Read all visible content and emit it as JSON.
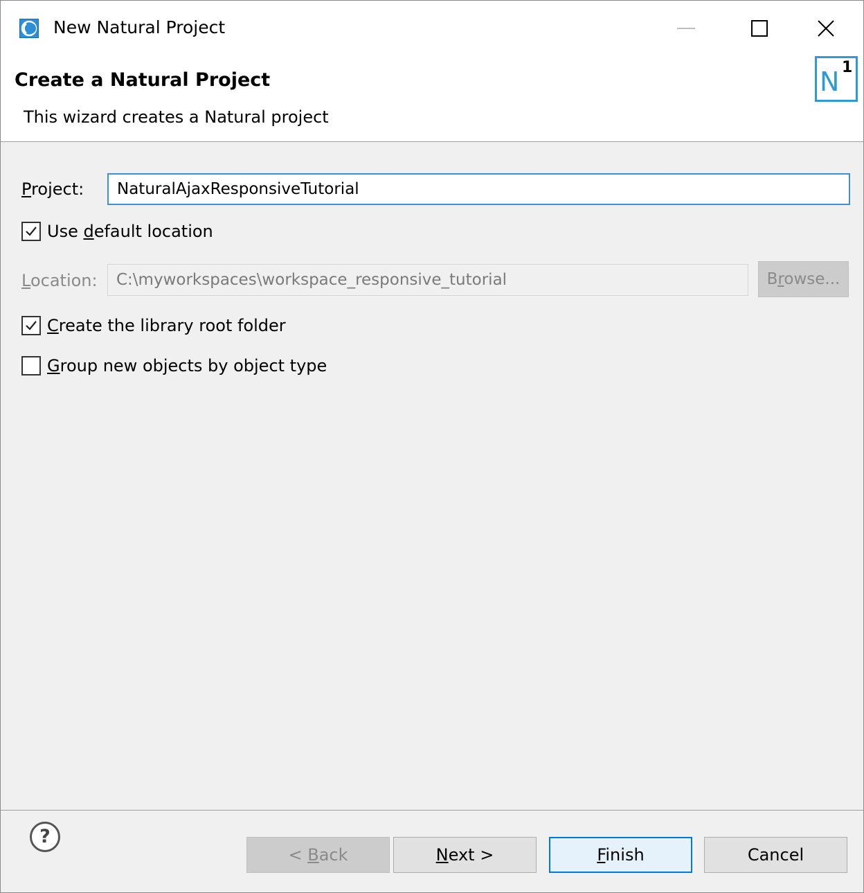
{
  "window": {
    "title": "New Natural Project",
    "icon": "natural-app-icon",
    "controls": {
      "minimize": "minimize-icon",
      "maximize": "maximize-icon",
      "close": "close-icon"
    }
  },
  "banner": {
    "title": "Create a Natural Project",
    "description": "This wizard creates a Natural project",
    "image": {
      "icon": "natural-one-logo",
      "letter": "N",
      "superscript": "1",
      "color": "#2b9ad6"
    }
  },
  "form": {
    "project": {
      "label": "Project:",
      "value": "NaturalAjaxResponsiveTutorial"
    },
    "use_default_location": {
      "label": "Use default location",
      "checked": true
    },
    "location": {
      "label": "Location:",
      "value": "C:\\myworkspaces\\workspace_responsive_tutorial",
      "enabled": false
    },
    "browse_label": "Browse...",
    "create_library_root": {
      "label": "Create the library root folder",
      "checked": true
    },
    "group_by_type": {
      "label": "Group new objects by object type",
      "checked": false
    }
  },
  "footer": {
    "help_icon": "help-icon",
    "help_glyph": "?",
    "back_label": "< Back",
    "next_label": "Next >",
    "finish_label": "Finish",
    "cancel_label": "Cancel",
    "default_button_color": "#0078d7"
  }
}
